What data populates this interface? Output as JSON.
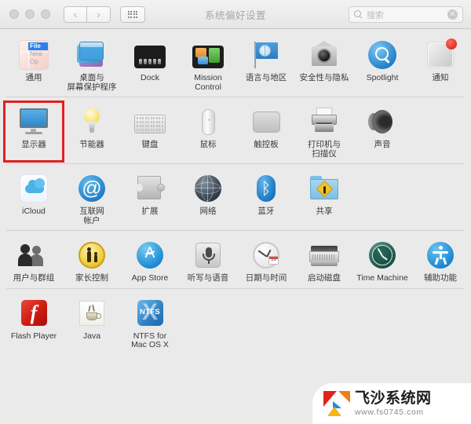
{
  "window": {
    "title": "系统偏好设置",
    "traffic_lights": [
      "close",
      "minimize",
      "zoom"
    ],
    "nav": {
      "back": "‹",
      "forward": "›",
      "show_all": "show-all-grid"
    },
    "search": {
      "placeholder": "搜索",
      "value": "",
      "clear": "✕"
    }
  },
  "rows": [
    {
      "items": [
        {
          "label": "通用",
          "icon": "general-icon",
          "selected": false
        },
        {
          "label": "桌面与\n屏幕保护程序",
          "icon": "desktop-screensaver-icon",
          "selected": false
        },
        {
          "label": "Dock",
          "icon": "dock-icon",
          "selected": false
        },
        {
          "label": "Mission\nControl",
          "icon": "mission-control-icon",
          "selected": false
        },
        {
          "label": "语言与地区",
          "icon": "language-region-icon",
          "selected": false
        },
        {
          "label": "安全性与隐私",
          "icon": "security-privacy-icon",
          "selected": false
        },
        {
          "label": "Spotlight",
          "icon": "spotlight-icon",
          "selected": false
        },
        {
          "label": "通知",
          "icon": "notifications-icon",
          "selected": false
        }
      ]
    },
    {
      "items": [
        {
          "label": "显示器",
          "icon": "displays-icon",
          "selected": true
        },
        {
          "label": "节能器",
          "icon": "energy-saver-icon",
          "selected": false
        },
        {
          "label": "键盘",
          "icon": "keyboard-icon",
          "selected": false
        },
        {
          "label": "鼠标",
          "icon": "mouse-icon",
          "selected": false
        },
        {
          "label": "触控板",
          "icon": "trackpad-icon",
          "selected": false
        },
        {
          "label": "打印机与\n扫描仪",
          "icon": "printers-scanners-icon",
          "selected": false
        },
        {
          "label": "声音",
          "icon": "sound-icon",
          "selected": false
        }
      ]
    },
    {
      "items": [
        {
          "label": "iCloud",
          "icon": "icloud-icon",
          "selected": false
        },
        {
          "label": "互联网\n帐户",
          "icon": "internet-accounts-icon",
          "selected": false
        },
        {
          "label": "扩展",
          "icon": "extensions-icon",
          "selected": false
        },
        {
          "label": "网络",
          "icon": "network-icon",
          "selected": false
        },
        {
          "label": "蓝牙",
          "icon": "bluetooth-icon",
          "selected": false
        },
        {
          "label": "共享",
          "icon": "sharing-icon",
          "selected": false
        }
      ]
    },
    {
      "items": [
        {
          "label": "用户与群组",
          "icon": "users-groups-icon",
          "selected": false
        },
        {
          "label": "家长控制",
          "icon": "parental-controls-icon",
          "selected": false
        },
        {
          "label": "App Store",
          "icon": "app-store-icon",
          "selected": false
        },
        {
          "label": "听写与语音",
          "icon": "dictation-speech-icon",
          "selected": false
        },
        {
          "label": "日期与时间",
          "icon": "date-time-icon",
          "selected": false
        },
        {
          "label": "启动磁盘",
          "icon": "startup-disk-icon",
          "selected": false
        },
        {
          "label": "Time Machine",
          "icon": "time-machine-icon",
          "selected": false
        },
        {
          "label": "辅助功能",
          "icon": "accessibility-icon",
          "selected": false
        }
      ]
    },
    {
      "items": [
        {
          "label": "Flash Player",
          "icon": "flash-player-icon",
          "selected": false
        },
        {
          "label": "Java",
          "icon": "java-icon",
          "selected": false
        },
        {
          "label": "NTFS for\nMac OS X",
          "icon": "ntfs-icon",
          "selected": false
        }
      ]
    }
  ],
  "icon_glyphs": {
    "general_menu_file": "File",
    "general_menu_new": "New",
    "general_menu_open": "Op",
    "bluetooth": "ᛒ",
    "at_sign": "@",
    "app_store_a": "A",
    "flash_f": "f",
    "ntfs_x": "X",
    "ntfs_label": "NTFS",
    "clock_cal_day": "19"
  },
  "watermark": {
    "title": "飞沙系统网",
    "url": "www.fs0745.com"
  },
  "colors": {
    "selection_red": "#e02020",
    "window_bg": "#eaeaea",
    "titlebar_bg": "#ececec",
    "label_text": "#3a3a3a",
    "title_text": "#a8a8a8"
  }
}
